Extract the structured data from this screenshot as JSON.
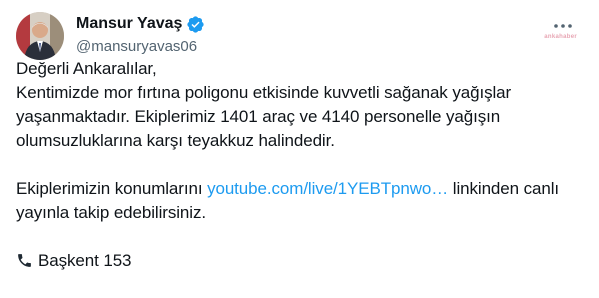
{
  "author": {
    "display_name": "Mansur Yavaş",
    "handle": "@mansuryavas06",
    "avatar_icon": "profile-avatar-icon",
    "verified_icon": "verified-badge-icon"
  },
  "overflow_icon": "more-options-icon",
  "watermark": "ankahaber",
  "body": {
    "line1": "Değerli Ankaralılar,",
    "line2": "Kentimizde mor fırtına poligonu etkisinde kuvvetli sağanak yağışlar",
    "line3": "yaşanmaktadır. Ekiplerimiz 1401 araç ve 4140 personelle yağışın",
    "line4": "olumsuzluklarına karşı teyakkuz halindedir.",
    "line5_before": "Ekiplerimizin konumlarını ",
    "line5_link": "youtube.com/live/1YEBTpnwo…",
    "line5_after": " linkinden canlı",
    "line6": "yayınla takip edebilirsiniz.",
    "line7_icon": "telephone-receiver-icon",
    "line7_text": "Başkent 153"
  },
  "colors": {
    "text": "#0f1419",
    "secondary": "#536471",
    "link": "#1d9bf0",
    "verified": "#1d9bf0"
  }
}
